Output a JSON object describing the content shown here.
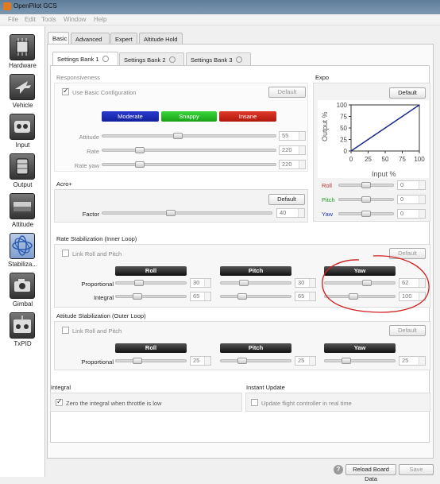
{
  "window": {
    "title": "OpenPilot GCS"
  },
  "menu": [
    "File",
    "Edit",
    "Tools",
    "Window",
    "Help"
  ],
  "nav": [
    {
      "label": "Hardware",
      "icon": "chip-icon"
    },
    {
      "label": "Vehicle",
      "icon": "plane-icon"
    },
    {
      "label": "Input",
      "icon": "gamepad-icon"
    },
    {
      "label": "Output",
      "icon": "motor-icon"
    },
    {
      "label": "Attitude",
      "icon": "attitude-icon"
    },
    {
      "label": "Stabiliza...",
      "icon": "stabilization-icon"
    },
    {
      "label": "Gimbal",
      "icon": "camera-icon"
    },
    {
      "label": "TxPID",
      "icon": "transmitter-icon"
    }
  ],
  "tabs": [
    "Basic",
    "Advanced",
    "Expert",
    "Altitude Hold"
  ],
  "banks": [
    "Settings Bank 1",
    "Settings Bank 2",
    "Settings Bank 3"
  ],
  "responsiveness": {
    "title": "Responsiveness",
    "use_basic": "Use Basic Configuration",
    "default": "Default",
    "moderate": "Moderate",
    "snappy": "Snappy",
    "insane": "Insane",
    "attitude": {
      "label": "Attitude",
      "value": "55",
      "level": 0.43
    },
    "rate": {
      "label": "Rate",
      "value": "220",
      "level": 0.2
    },
    "rate_yaw": {
      "label": "Rate yaw",
      "value": "220",
      "level": 0.2
    }
  },
  "expo": {
    "title": "Expo",
    "default": "Default",
    "chart_data": {
      "type": "line",
      "xlabel": "Input %",
      "ylabel": "Output %",
      "x_ticks": [
        "0",
        "25",
        "50",
        "75",
        "100"
      ],
      "y_ticks": [
        "0",
        "25",
        "50",
        "75",
        "100"
      ],
      "xlim": [
        0,
        100
      ],
      "ylim": [
        0,
        100
      ],
      "series": [
        {
          "x": [
            0,
            100
          ],
          "y": [
            0,
            100
          ],
          "color": "#1a2a8a"
        }
      ]
    },
    "roll": {
      "label": "Roll",
      "value": "0",
      "color": "#c03030",
      "level": 0.5
    },
    "pitch": {
      "label": "Pitch",
      "value": "0",
      "color": "#2a9a2a",
      "level": 0.5
    },
    "yaw": {
      "label": "Yaw",
      "value": "0",
      "color": "#2a3aa8",
      "level": 0.5
    }
  },
  "acro": {
    "title": "Acro+",
    "default": "Default",
    "factor_label": "Factor",
    "factor_value": "40",
    "level": 0.4
  },
  "rate_stab": {
    "title": "Rate Stabilization (Inner Loop)",
    "link": "Link Roll and Pitch",
    "default": "Default",
    "roll": "Roll",
    "pitch": "Pitch",
    "yaw": "Yaw",
    "proportional": "Proportional",
    "integral": "Integral",
    "p_values": [
      "30",
      "30",
      "62"
    ],
    "i_values": [
      "65",
      "65",
      "100"
    ],
    "p_levels": [
      0.3,
      0.3,
      0.62
    ],
    "i_levels": [
      0.27,
      0.27,
      0.4
    ]
  },
  "att_stab": {
    "title": "Attitude Stabilization (Outer Loop)",
    "link": "Link Roll and Pitch",
    "default": "Default",
    "roll": "Roll",
    "pitch": "Pitch",
    "yaw": "Yaw",
    "proportional": "Proportional",
    "p_values": [
      "25",
      "25",
      "25"
    ],
    "p_levels": [
      0.27,
      0.27,
      0.27
    ]
  },
  "integral": {
    "title": "Integral",
    "zero": "Zero the integral when throttle is low"
  },
  "instant": {
    "title": "Instant Update",
    "update": "Update flight controller in real time"
  },
  "footer": {
    "reload": "Reload Board Data",
    "save": "Save",
    "help_icon": "question-icon"
  }
}
